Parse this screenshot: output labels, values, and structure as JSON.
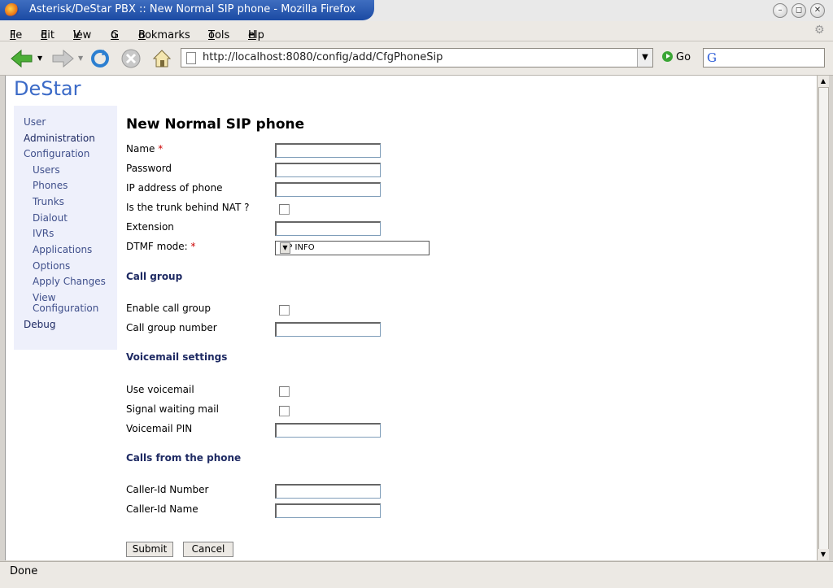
{
  "window": {
    "title": "Asterisk/DeStar PBX :: New Normal SIP phone - Mozilla Firefox"
  },
  "menu": [
    "File",
    "Edit",
    "View",
    "Go",
    "Bookmarks",
    "Tools",
    "Help"
  ],
  "menu_accel": [
    "F",
    "E",
    "V",
    "G",
    "B",
    "T",
    "H"
  ],
  "toolbar": {
    "url": "http://localhost:8080/config/add/CfgPhoneSip",
    "go_label": "Go"
  },
  "status": {
    "text": "Done"
  },
  "page": {
    "logo": "DeStar",
    "title": "New Normal SIP phone",
    "sidebar": [
      "User",
      "Administration",
      "Configuration",
      "Users",
      "Phones",
      "Trunks",
      "Dialout",
      "IVRs",
      "Applications",
      "Options",
      "Apply Changes",
      "View",
      "Configuration",
      "Debug"
    ],
    "form": {
      "name_label": "Name",
      "password_label": "Password",
      "ip_label": "IP address of phone",
      "nat_label": "Is the trunk behind NAT ?",
      "extension_label": "Extension",
      "dtmf_label": "DTMF mode:",
      "dtmf_value": "SIP INFO",
      "required_mark": "*",
      "section_call_group": "Call group",
      "enable_call_group_label": "Enable call group",
      "call_group_number_label": "Call group number",
      "section_voicemail": "Voicemail settings",
      "use_voicemail_label": "Use voicemail",
      "signal_waiting_label": "Signal waiting mail",
      "voicemail_pin_label": "Voicemail PIN",
      "section_calls": "Calls from the phone",
      "callerid_number_label": "Caller-Id Number",
      "callerid_name_label": "Caller-Id Name",
      "submit_label": "Submit",
      "cancel_label": "Cancel"
    }
  }
}
